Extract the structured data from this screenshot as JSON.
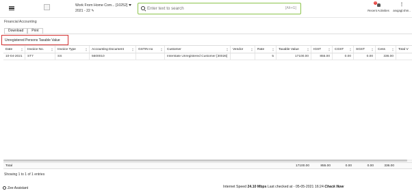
{
  "header": {
    "company": "Work From Home Com... [10252]",
    "fiscal_year": "2021 - 22",
    "search_placeholder": "Enter text to search",
    "search_shortcut": "[Alt+G]",
    "recent_label": "Recent Activities",
    "notification_count": "0",
    "user_name": "anujagl.shm..",
    "user_menu": "⋮"
  },
  "breadcrumb": "Financial Accounting",
  "tabs": [
    {
      "label": "Download"
    },
    {
      "label": "Print"
    }
  ],
  "report_title": "Unregistered Persons Taxable Value",
  "table": {
    "columns": [
      "Date",
      "Invoice No.",
      "Invoice Type",
      "Accounting Document",
      "GSTIN no",
      "Customer",
      "Vendor",
      "Rate",
      "Taxable Value",
      "IGST",
      "CGST",
      "SGST",
      "Cess",
      "Total V"
    ],
    "rows": [
      [
        "10-04-2021",
        "ST7",
        "SS",
        "5600010",
        "",
        "Interstate Unregistered Customer [30026]",
        "",
        "5",
        "17100.00",
        "855.00",
        "0.00",
        "0.00",
        "336.00",
        ""
      ]
    ],
    "totals": {
      "label": "Total",
      "taxable_value": "17100.00",
      "igst": "855.00",
      "cgst": "0.00",
      "sgst": "0.00",
      "cess": "336.00"
    }
  },
  "entries_text": "Showing 1 to 1 of 1 entries",
  "footer": {
    "assistant": "Zee Assistant",
    "speed_prefix": "Internet Speed",
    "speed_value": "24.10 Mbps",
    "last_checked": "Last checked at - 05-05-2021 16:24",
    "check_now": "Check Now"
  }
}
